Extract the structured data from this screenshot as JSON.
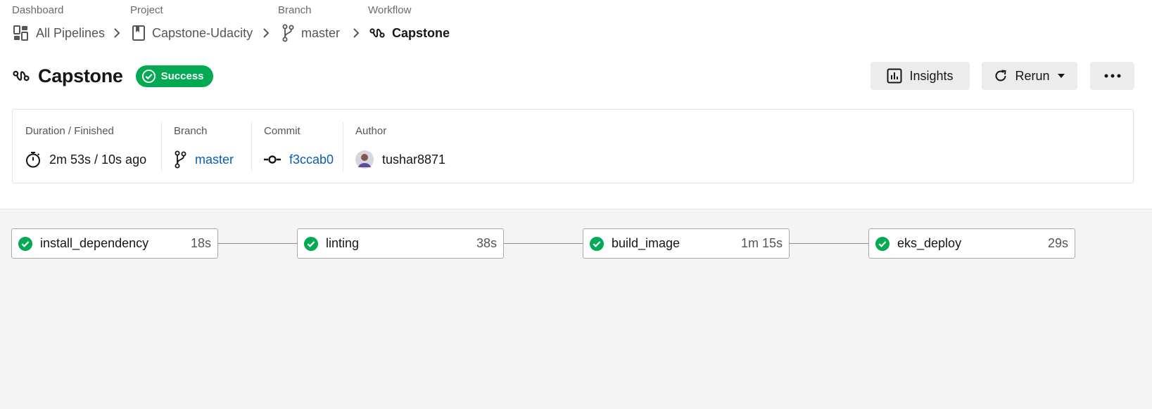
{
  "breadcrumbs": [
    {
      "caption": "Dashboard",
      "label": "All Pipelines",
      "icon": "dashboard-icon"
    },
    {
      "caption": "Project",
      "label": "Capstone-Udacity",
      "icon": "bookmark-icon"
    },
    {
      "caption": "Branch",
      "label": "master",
      "icon": "branch-icon"
    },
    {
      "caption": "Workflow",
      "label": "Capstone",
      "icon": "workflow-icon"
    }
  ],
  "workflow": {
    "title": "Capstone",
    "status": "Success",
    "status_color": "#04a954"
  },
  "actions": {
    "insights_label": "Insights",
    "rerun_label": "Rerun",
    "more_icon": "more-icon"
  },
  "info": {
    "duration_caption": "Duration / Finished",
    "duration_value": "2m 53s / 10s ago",
    "branch_caption": "Branch",
    "branch_value": "master",
    "commit_caption": "Commit",
    "commit_value": "f3ccab0",
    "author_caption": "Author",
    "author_value": "tushar8871"
  },
  "jobs": [
    {
      "name": "install_dependency",
      "duration": "18s",
      "status": "success"
    },
    {
      "name": "linting",
      "duration": "38s",
      "status": "success"
    },
    {
      "name": "build_image",
      "duration": "1m 15s",
      "status": "success"
    },
    {
      "name": "eks_deploy",
      "duration": "29s",
      "status": "success"
    }
  ],
  "colors": {
    "success": "#04a954",
    "link": "#0b5bb5",
    "canvas_bg": "#f4f4f4"
  }
}
